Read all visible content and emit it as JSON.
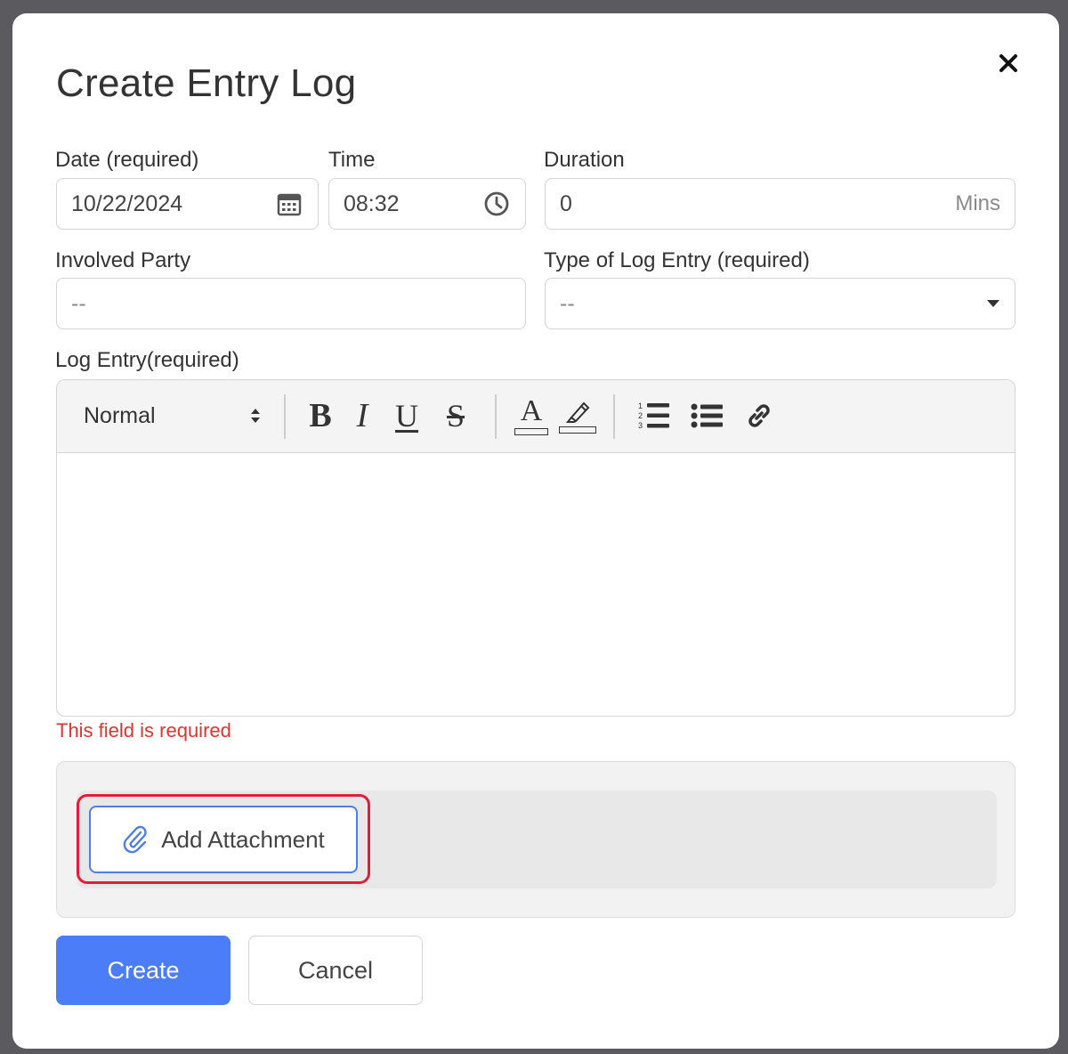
{
  "modal": {
    "title": "Create Entry Log",
    "close_icon": "close-icon"
  },
  "form": {
    "date": {
      "label": "Date (required)",
      "value": "10/22/2024",
      "icon": "calendar-icon"
    },
    "time": {
      "label": "Time",
      "value": "08:32",
      "icon": "clock-icon"
    },
    "duration": {
      "label": "Duration",
      "value": "0",
      "suffix": "Mins"
    },
    "involved_party": {
      "label": "Involved Party",
      "placeholder": "--"
    },
    "log_type": {
      "label": "Type of Log Entry (required)",
      "selected": "--",
      "icon": "caret-down-icon"
    },
    "log_entry": {
      "label": "Log Entry(required)",
      "error": "This field is required",
      "toolbar": {
        "heading": "Normal",
        "bold": "B",
        "italic": "I",
        "underline": "U",
        "strike": "S",
        "font_color": "A"
      }
    }
  },
  "attachment": {
    "button_label": "Add Attachment",
    "icon": "paperclip-icon"
  },
  "actions": {
    "create_label": "Create",
    "cancel_label": "Cancel"
  },
  "colors": {
    "primary": "#4a7df7",
    "error": "#e0342f",
    "highlight": "#e11d3a"
  }
}
